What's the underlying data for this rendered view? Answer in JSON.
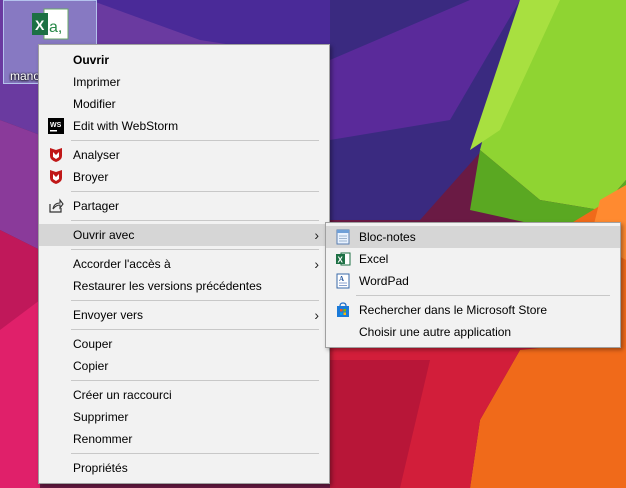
{
  "desktop": {
    "file_label": "mano",
    "file_icon": "excel-csv-file-icon"
  },
  "context_menu": {
    "items": [
      {
        "label": "Ouvrir"
      },
      {
        "label": "Imprimer"
      },
      {
        "label": "Modifier"
      },
      {
        "label": "Edit with WebStorm",
        "icon": "webstorm-icon"
      },
      {
        "label": "Analyser",
        "icon": "mcafee-shield-icon"
      },
      {
        "label": "Broyer",
        "icon": "mcafee-shield-icon"
      },
      {
        "label": "Partager",
        "icon": "share-icon"
      },
      {
        "label": "Ouvrir avec",
        "icon": "chevron-right-icon"
      },
      {
        "label": "Accorder l'accès à",
        "icon": "chevron-right-icon"
      },
      {
        "label": "Restaurer les versions précédentes"
      },
      {
        "label": "Envoyer vers",
        "icon": "chevron-right-icon"
      },
      {
        "label": "Couper"
      },
      {
        "label": "Copier"
      },
      {
        "label": "Créer un raccourci"
      },
      {
        "label": "Supprimer"
      },
      {
        "label": "Renommer"
      },
      {
        "label": "Propriétés"
      }
    ]
  },
  "submenu": {
    "items": [
      {
        "label": "Bloc-notes",
        "icon": "notepad-icon"
      },
      {
        "label": "Excel",
        "icon": "excel-icon"
      },
      {
        "label": "WordPad",
        "icon": "wordpad-icon"
      },
      {
        "label": "Rechercher dans le Microsoft Store",
        "icon": "store-icon"
      },
      {
        "label": "Choisir une autre application"
      }
    ]
  },
  "colors": {
    "menu_bg": "#f2f2f2",
    "highlight": "#d6d6d6",
    "excel_green": "#1d7044",
    "mcafee_red": "#c01818"
  }
}
